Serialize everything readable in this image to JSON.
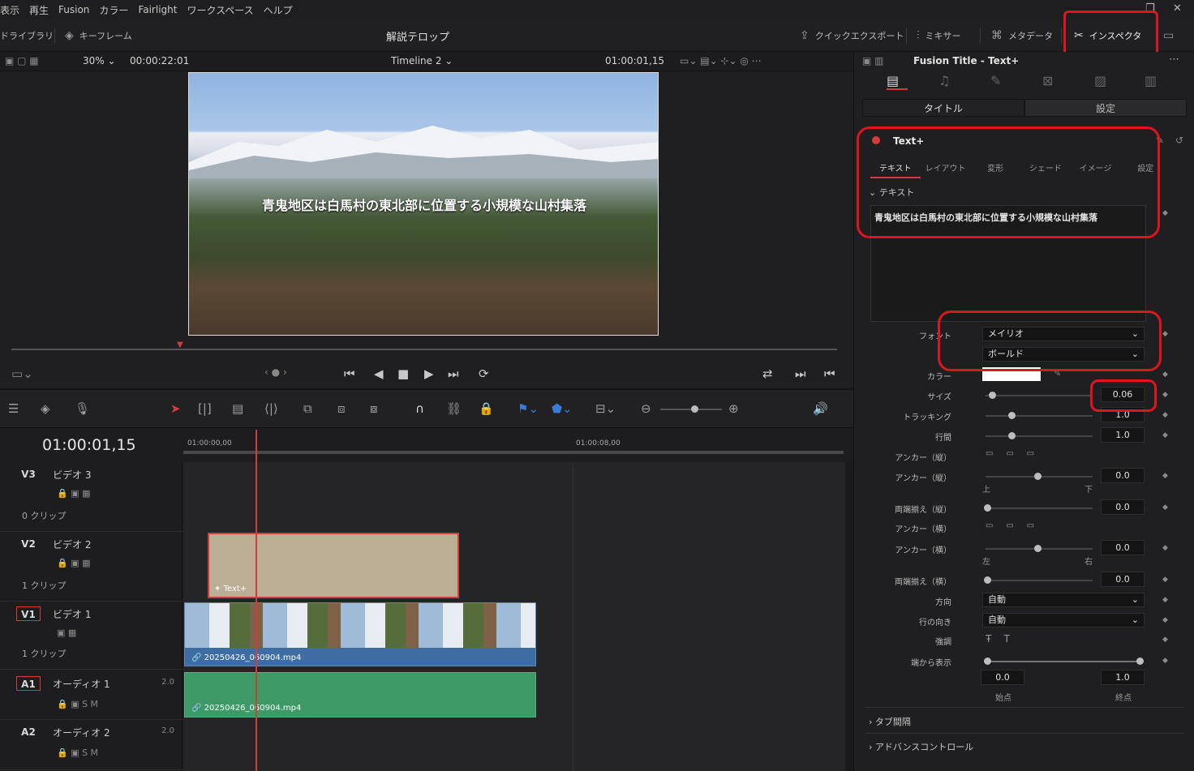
{
  "menu": {
    "items": [
      "表示",
      "再生",
      "Fusion",
      "カラー",
      "Fairlight",
      "ワークスペース",
      "ヘルプ"
    ]
  },
  "toolbar": {
    "media_pool": "ドライブラリ",
    "keyframes": "キーフレーム",
    "project_title": "解説テロップ",
    "quick_export": "クイックエクスポート",
    "mixer": "ミキサー",
    "metadata": "メタデータ",
    "inspector": "インスペクタ"
  },
  "viewer": {
    "zoom": "30%",
    "source_timecode": "00:00:22:01",
    "timeline_name": "Timeline 2",
    "record_timecode": "01:00:01,15",
    "caption": "青鬼地区は白馬村の東北部に位置する小規模な山村集落"
  },
  "timeline": {
    "big_timecode": "01:00:01,15",
    "ruler_start": "01:00:00,00",
    "ruler_mid": "01:00:08,00",
    "tracks": [
      {
        "id": "V3",
        "name": "ビデオ 3",
        "count": "0 クリップ"
      },
      {
        "id": "V2",
        "name": "ビデオ 2",
        "count": "1 クリップ"
      },
      {
        "id": "V1",
        "name": "ビデオ 1",
        "count": "1 クリップ"
      },
      {
        "id": "A1",
        "name": "オーディオ 1",
        "level": "2.0"
      },
      {
        "id": "A2",
        "name": "オーディオ 2",
        "level": "2.0"
      }
    ],
    "clip_text": "Text+",
    "clip_video": "20250426_060904.mp4",
    "clip_audio": "20250426_060904.mp4"
  },
  "inspector": {
    "title": "Fusion Title - Text+",
    "tab_title": "タイトル",
    "tab_settings": "設定",
    "node_name": "Text+",
    "subtabs": [
      "テキスト",
      "レイアウト",
      "変形",
      "シェード",
      "イメージ",
      "設定"
    ],
    "section_text": "テキスト",
    "text_value": "青鬼地区は白馬村の東北部に位置する小規模な山村集落",
    "font_label": "フォント",
    "font": "メイリオ",
    "style": "ボールド",
    "color_label": "カラー",
    "color": "#ffffff",
    "size_label": "サイズ",
    "size": "0.06",
    "tracking_label": "トラッキング",
    "tracking": "1.0",
    "line_label": "行間",
    "line": "1.0",
    "anchor_v_label": "アンカー（縦）",
    "anchor_v2_label": "アンカー（縦）",
    "anchor_v": "0.0",
    "top": "上",
    "bottom": "下",
    "justify_v_label": "両端揃え（縦）",
    "justify_v": "0.0",
    "anchor_h_label": "アンカー（横）",
    "anchor_h2_label": "アンカー（横）",
    "anchor_h": "0.0",
    "left": "左",
    "right": "右",
    "justify_h_label": "両端揃え（横）",
    "justify_h": "0.0",
    "direction_label": "方向",
    "direction": "自動",
    "line_dir_label": "行の向き",
    "line_dir": "自動",
    "emphasis_label": "強調",
    "write_label": "端から表示",
    "start_val": "0.0",
    "end_val": "1.0",
    "start": "始点",
    "end": "終点",
    "tab_spacing": "タブ間隔",
    "advanced": "アドバンスコントロール"
  }
}
